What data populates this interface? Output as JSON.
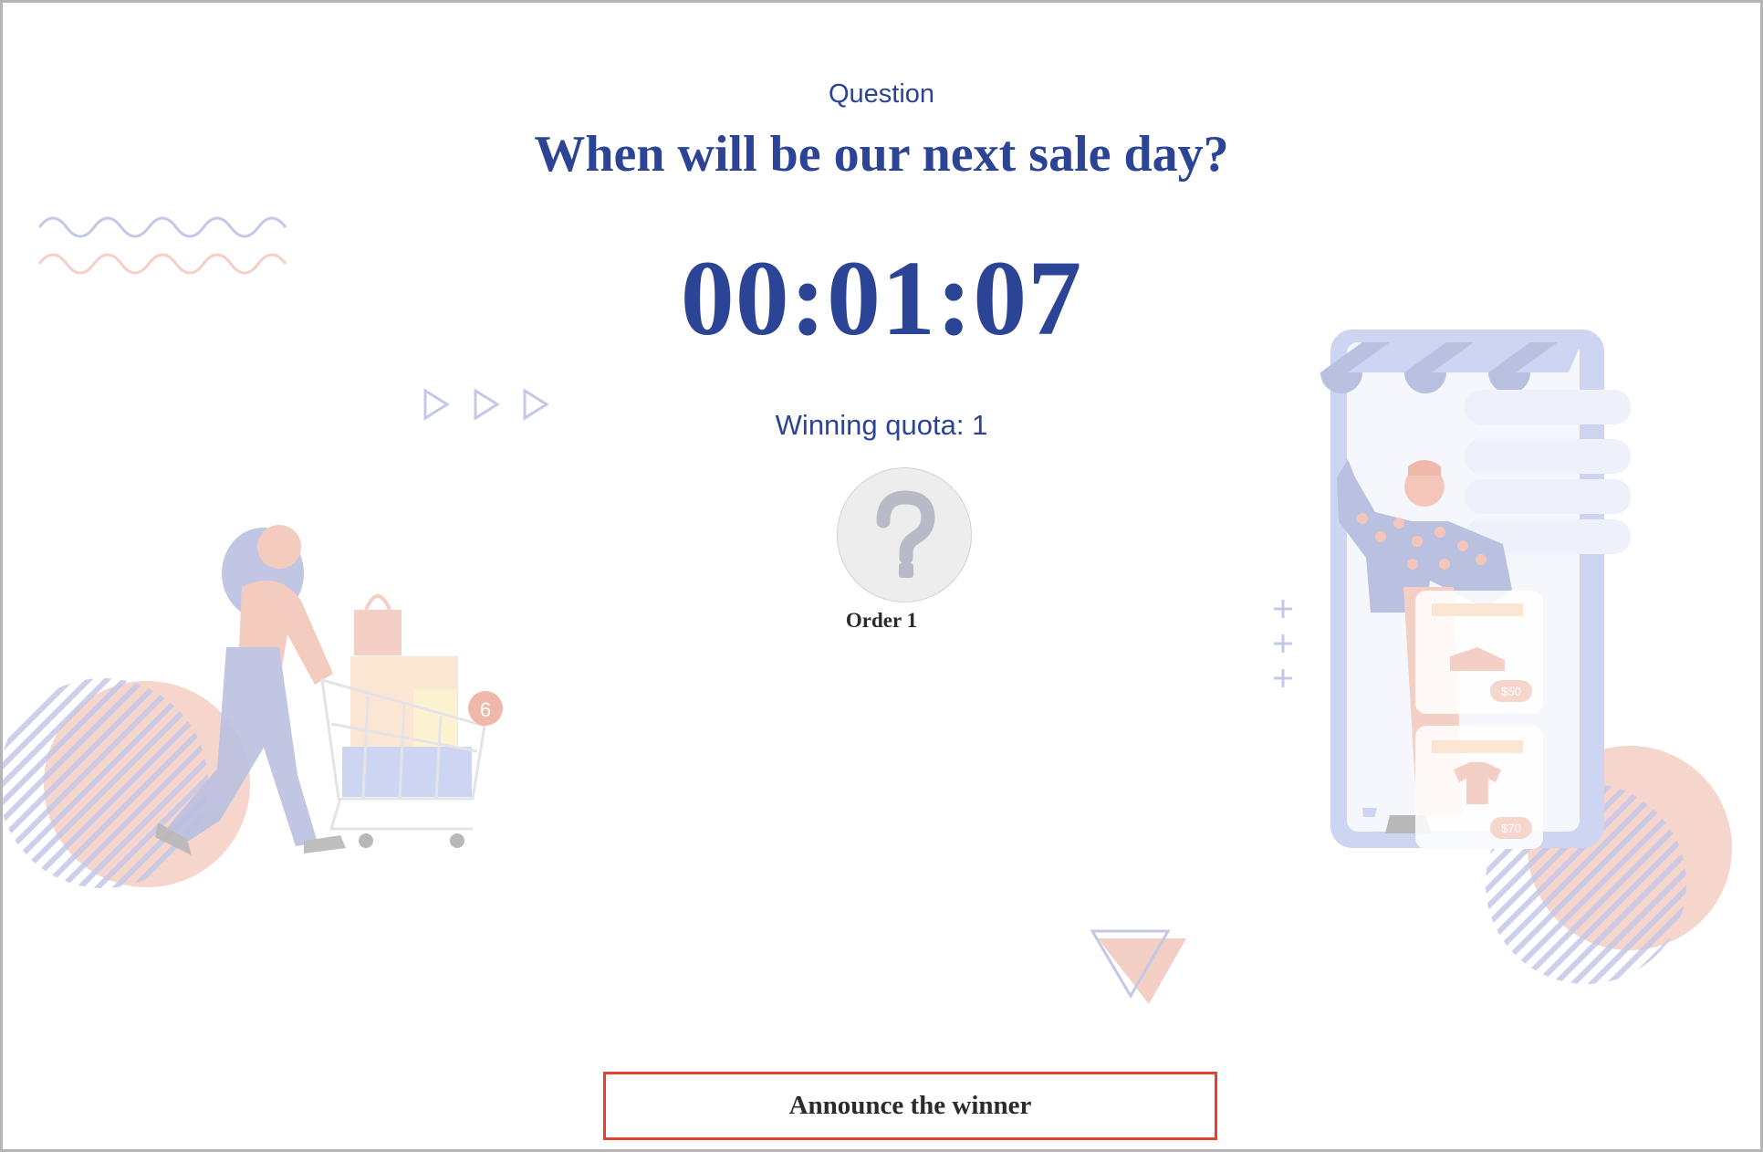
{
  "question": {
    "label": "Question",
    "title": "When will be our next sale day?"
  },
  "countdown": "00:01:07",
  "winning_quota": "Winning quota: 1",
  "winner_slot": {
    "icon": "question-mark-icon",
    "order_label": "Order 1"
  },
  "actions": {
    "announce_label": "Announce the winner"
  },
  "colors": {
    "primary": "#2b4496",
    "button_border": "#e2432c",
    "accent_pink": "#f4c9bd",
    "accent_lavender": "#b9bfe0"
  },
  "illustrations": {
    "left": "shopper-with-cart-illustration",
    "right": "phone-storefront-illustration",
    "cart_badge": "6",
    "price_tags": [
      "$50",
      "$70"
    ]
  }
}
